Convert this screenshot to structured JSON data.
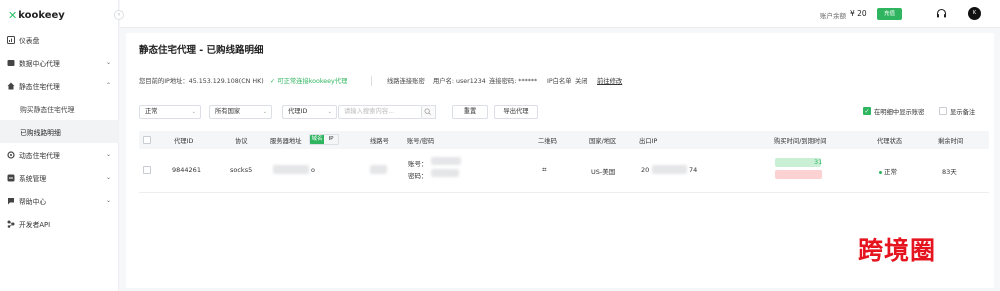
{
  "brand": {
    "name": "kookeey",
    "mark": "✕"
  },
  "sidebar": {
    "items": [
      {
        "label": "仪表盘",
        "icon": "dashboard-icon"
      },
      {
        "label": "数据中心代理",
        "icon": "server-icon"
      },
      {
        "label": "静态住宅代理",
        "icon": "home-icon"
      },
      {
        "label": "动态住宅代理",
        "icon": "refresh-icon"
      },
      {
        "label": "系统管理",
        "icon": "settings-icon"
      },
      {
        "label": "帮助中心",
        "icon": "help-icon"
      },
      {
        "label": "开发者API",
        "icon": "api-icon"
      }
    ],
    "subitems": [
      {
        "label": "购买静态住宅代理"
      },
      {
        "label": "已购线路明细"
      }
    ]
  },
  "topbar": {
    "balance_label": "账户余额",
    "balance_value": "¥ 20",
    "recharge_label": "充值",
    "avatar_text": "K"
  },
  "page": {
    "title": "静态住宅代理 - 已购线路明细",
    "ip_label": "您目前的IP地址：45.153.129.108(CN HK)",
    "status_text": "✓ 可正常连接kookeey代理",
    "conn_label": "线路连接账密",
    "username_label": "用户名: user1234",
    "password_label": "连接密码: ******",
    "whitelist_label": "IP白名单",
    "whitelist_state": "关闭",
    "whitelist_link": "前往修改"
  },
  "filters": {
    "status": "正常",
    "country": "所有国家",
    "proxy_type": "代理ID",
    "search_placeholder": "请输入搜索内容...",
    "reset_label": "重置",
    "export_label": "导出代理",
    "show_in_list_label": "在明细中显示账密",
    "show_remark_label": "显示备注"
  },
  "table": {
    "headers": {
      "proxy_id": "代理ID",
      "protocol": "协议",
      "server": "服务器地址",
      "line": "线路号",
      "account": "账号/密码",
      "qr": "二维码",
      "country": "国家/地区",
      "exit_ip": "出口IP",
      "time": "购买时间/到期时间",
      "status": "代理状态",
      "remaining": "剩余时间"
    },
    "segment": [
      "域名",
      "IP"
    ],
    "rows": [
      {
        "proxy_id": "9844261",
        "protocol": "socks5",
        "server_suffix": "o",
        "account_prefix": "账号：",
        "password_prefix": "密码：",
        "qr_text": "⌗",
        "country": "US-美国",
        "exit_ip_start": "20",
        "exit_ip_end": "74",
        "time_tail": "31",
        "status": "正常",
        "remaining": "83天"
      }
    ]
  },
  "watermark": "跨境圈",
  "colors": {
    "accent": "#2fb55f",
    "watermark": "#e5141f"
  }
}
